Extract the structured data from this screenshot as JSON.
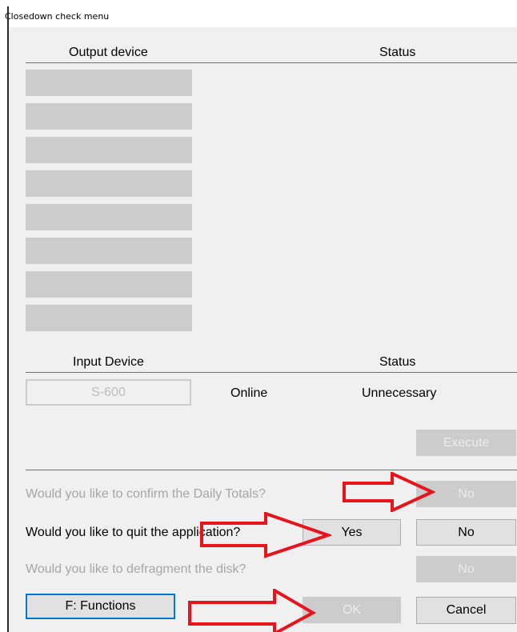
{
  "window": {
    "title": "Closedown check menu"
  },
  "output_section": {
    "device_header": "Output device",
    "status_header": "Status",
    "slot_count": 8
  },
  "input_section": {
    "device_header": "Input Device",
    "status_header": "Status",
    "device_button": "S-600",
    "state": "Online",
    "status": "Unnecessary"
  },
  "execute_button": "Execute",
  "questions": [
    {
      "text": "Would you like to confirm the Daily Totals?",
      "enabled": false,
      "no_label": "No"
    },
    {
      "text": "Would you like to quit the application?",
      "enabled": true,
      "yes_label": "Yes",
      "no_label": "No"
    },
    {
      "text": "Would you like to defragment the disk?",
      "enabled": false,
      "no_label": "No"
    }
  ],
  "footer": {
    "functions_label": "F: Functions",
    "ok_label": "OK",
    "cancel_label": "Cancel"
  },
  "annotations": {
    "arrow_color": "#e8141c"
  }
}
